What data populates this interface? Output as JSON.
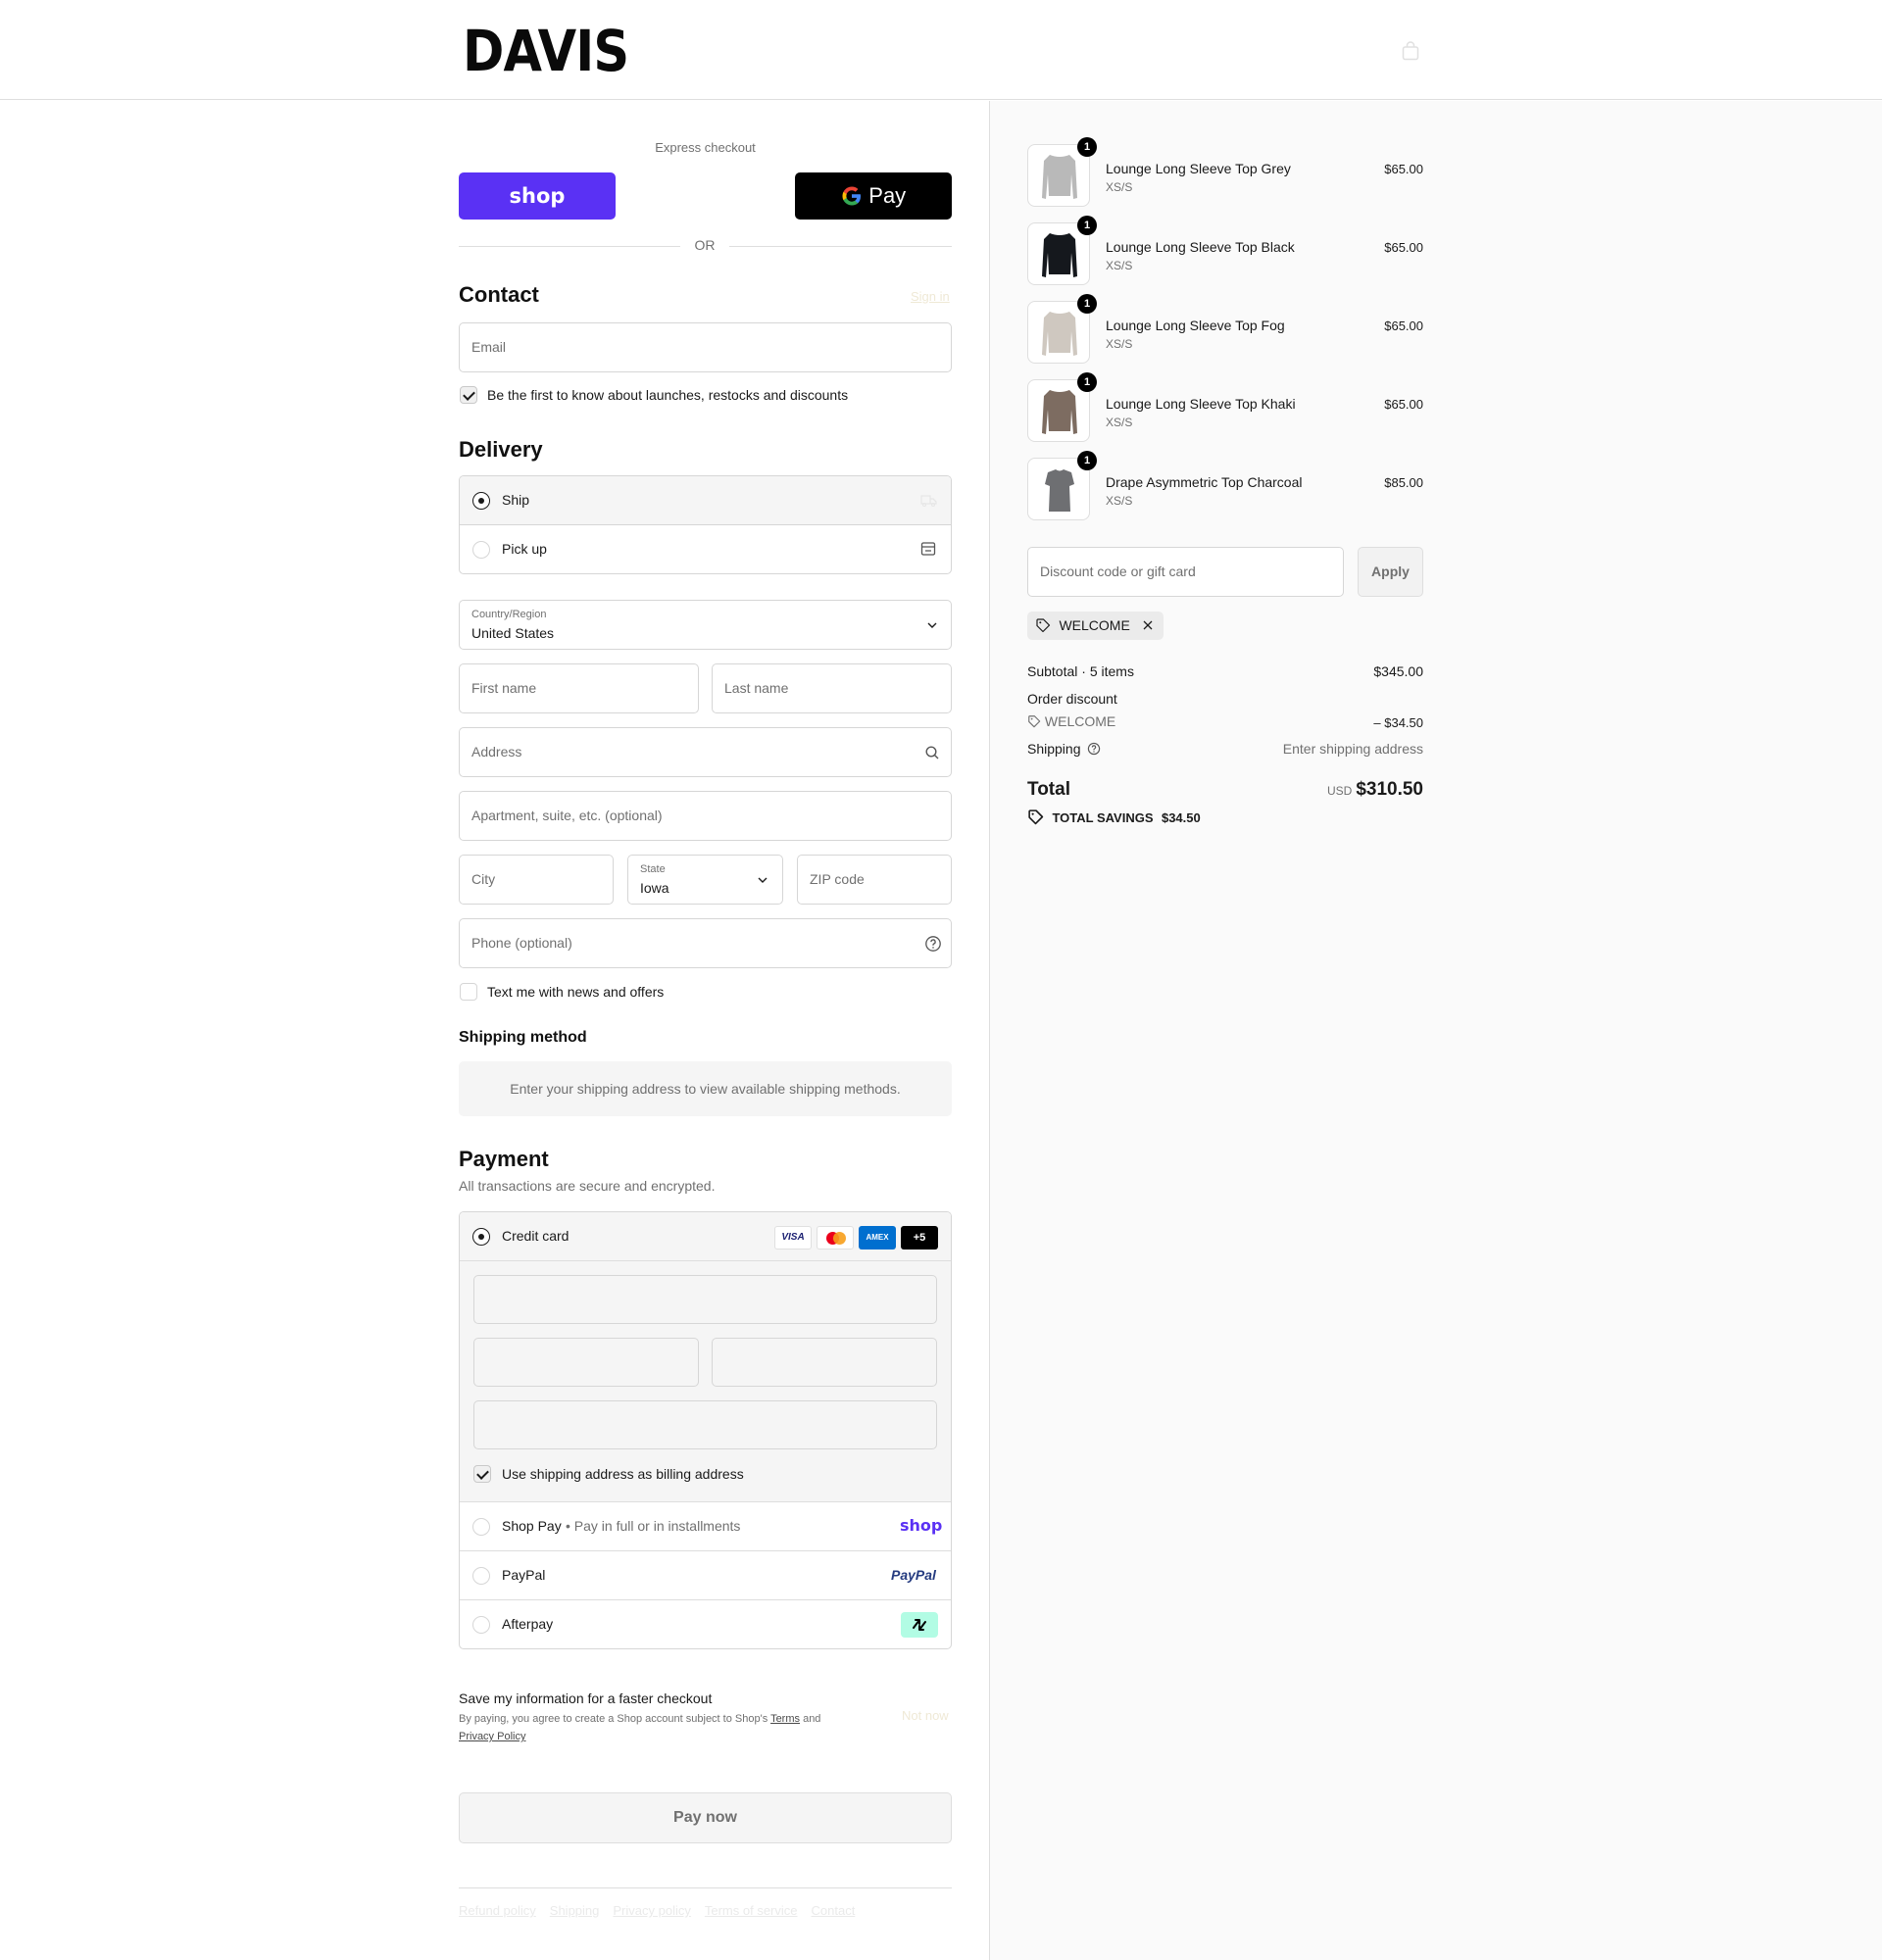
{
  "header": {
    "logo": "DAVIS"
  },
  "express": {
    "label": "Express checkout",
    "shop_pay": "shop",
    "gpay": "Pay",
    "or": "OR"
  },
  "contact": {
    "title": "Contact",
    "sign_in": "Sign in",
    "email_placeholder": "Email",
    "marketing_label": "Be the first to know about launches, restocks and discounts",
    "marketing_checked": true
  },
  "delivery": {
    "title": "Delivery",
    "options": [
      {
        "label": "Ship",
        "selected": true
      },
      {
        "label": "Pick up",
        "selected": false
      }
    ],
    "country_label": "Country/Region",
    "country_value": "United States",
    "first_name": "First name",
    "last_name": "Last name",
    "address": "Address",
    "apartment": "Apartment, suite, etc. (optional)",
    "city": "City",
    "state_label": "State",
    "state_value": "Iowa",
    "zip": "ZIP code",
    "phone": "Phone (optional)",
    "sms_label": "Text me with news and offers",
    "sms_checked": false
  },
  "shipping_method": {
    "title": "Shipping method",
    "notice": "Enter your shipping address to view available shipping methods."
  },
  "payment": {
    "title": "Payment",
    "subtitle": "All transactions are secure and encrypted.",
    "credit_card": "Credit card",
    "card_badges": [
      "VISA",
      "",
      "AMEX",
      "+5"
    ],
    "billing_label": "Use shipping address as billing address",
    "billing_checked": true,
    "shop_pay": "Shop Pay",
    "shop_pay_note": "Pay in full or in installments",
    "shop_pay_logo": "shop",
    "paypal": "PayPal",
    "paypal_logo": "PayPal",
    "afterpay": "Afterpay"
  },
  "save_info": {
    "title": "Save my information for a faster checkout",
    "legal_prefix": "By paying, you agree to create a Shop account subject to Shop's ",
    "terms": "Terms",
    "and": " and",
    "privacy": "Privacy Policy",
    "not_now": "Not now"
  },
  "pay_button": "Pay now",
  "footer_links": [
    "Refund policy",
    "Shipping",
    "Privacy policy",
    "Terms of service",
    "Contact"
  ],
  "cart": {
    "items": [
      {
        "name": "Lounge Long Sleeve Top Grey",
        "variant": "XS/S",
        "price": "$65.00",
        "qty": "1",
        "color": "#b9b9b9"
      },
      {
        "name": "Lounge Long Sleeve Top Black",
        "variant": "XS/S",
        "price": "$65.00",
        "qty": "1",
        "color": "#15181d"
      },
      {
        "name": "Lounge Long Sleeve Top Fog",
        "variant": "XS/S",
        "price": "$65.00",
        "qty": "1",
        "color": "#cfc8c0"
      },
      {
        "name": "Lounge Long Sleeve Top Khaki",
        "variant": "XS/S",
        "price": "$65.00",
        "qty": "1",
        "color": "#7d6c61"
      },
      {
        "name": "Drape Asymmetric Top Charcoal",
        "variant": "XS/S",
        "price": "$85.00",
        "qty": "1",
        "color": "#6e6f72"
      }
    ],
    "discount_placeholder": "Discount code or gift card",
    "apply": "Apply",
    "code_tag": "WELCOME",
    "subtotal_label": "Subtotal · 5 items",
    "subtotal_value": "$345.00",
    "order_discount_label": "Order discount",
    "discount_code": "WELCOME",
    "discount_value": "– $34.50",
    "shipping_label": "Shipping",
    "shipping_value": "Enter shipping address",
    "total_label": "Total",
    "currency": "USD",
    "total_value": "$310.50",
    "savings_label": "TOTAL SAVINGS",
    "savings_value": "$34.50"
  },
  "colors": {
    "shop_purple": "#5a31f4",
    "gpay_black": "#000000",
    "afterpay_mint": "#b2fce4",
    "paypal_blue": "#253b80"
  }
}
